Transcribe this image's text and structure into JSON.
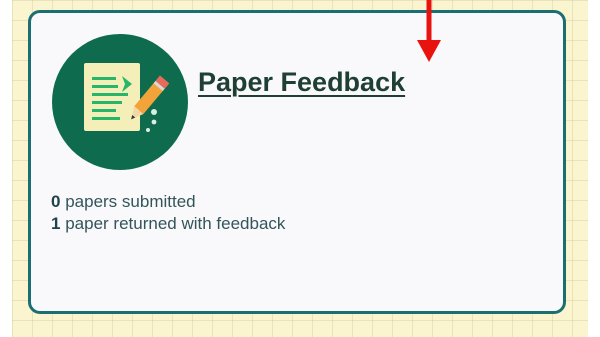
{
  "card": {
    "title": "Paper Feedback",
    "icon": "paper-pencil-icon",
    "stats": [
      {
        "count": "0",
        "label": "papers submitted"
      },
      {
        "count": "1",
        "label": "paper returned with feedback"
      }
    ]
  },
  "colors": {
    "card_border": "#1b6f73",
    "icon_background": "#0f6b4e",
    "page_background": "#fbf5cf",
    "arrow": "#e8130e"
  },
  "annotation": {
    "icon": "red-down-arrow-icon"
  }
}
